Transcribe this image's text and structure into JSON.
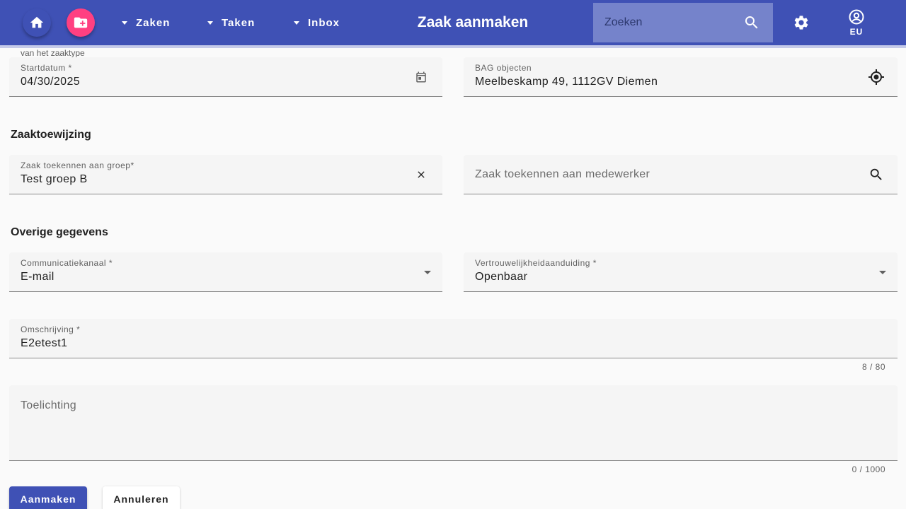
{
  "header": {
    "title": "Zaak aanmaken",
    "menus": [
      {
        "label": "Zaken"
      },
      {
        "label": "Taken"
      },
      {
        "label": "Inbox"
      }
    ],
    "search_placeholder": "Zoeken",
    "account_label": "EU",
    "toolbar_color": "#3f51b5",
    "new_button_color": "#ff4081",
    "icons": {
      "home": "home-icon",
      "new": "create-new-folder-icon",
      "search": "search-icon",
      "settings": "gear-icon",
      "account": "account-circle-icon"
    }
  },
  "form": {
    "zaaktype_hint": "van het zaaktype",
    "startdatum": {
      "label": "Startdatum *",
      "value": "04/30/2025"
    },
    "bag": {
      "label": "BAG objecten",
      "value": "Meelbeskamp 49, 1112GV Diemen"
    },
    "section_assignment": "Zaaktoewijzing",
    "groep": {
      "label": "Zaak toekennen aan groep*",
      "value": "Test groep B"
    },
    "medewerker": {
      "placeholder": "Zaak toekennen aan medewerker"
    },
    "section_other": "Overige gegevens",
    "communicatiekanaal": {
      "label": "Communicatiekanaal *",
      "value": "E-mail"
    },
    "vertrouwelijkheid": {
      "label": "Vertrouwelijkheidaanduiding *",
      "value": "Openbaar"
    },
    "omschrijving": {
      "label": "Omschrijving *",
      "value": "E2etest1",
      "counter": "8 / 80"
    },
    "toelichting": {
      "placeholder": "Toelichting",
      "counter": "0 / 1000"
    }
  },
  "actions": {
    "submit": "Aanmaken",
    "cancel": "Annuleren"
  }
}
